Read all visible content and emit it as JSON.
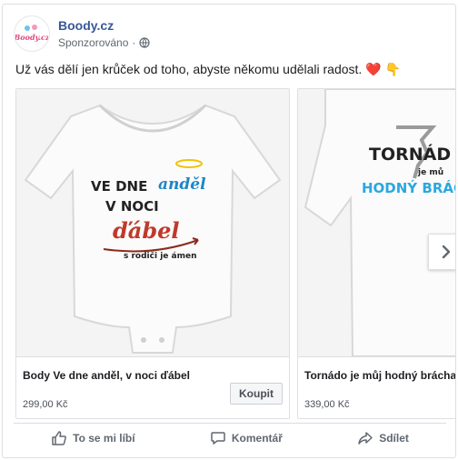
{
  "page": {
    "name": "Boody.cz",
    "logo_text": "Boody.cz",
    "sponsored": "Sponzorováno",
    "separator": "·",
    "icons": [
      "globe-icon"
    ]
  },
  "post": {
    "message": "Už vás dělí jen krůček od toho, abyste někomu udělali radost. ❤️ 👇"
  },
  "carousel": {
    "cards": [
      {
        "image_lines": [
          "VE DNE",
          "anděl",
          "V NOCI",
          "ďábel",
          "s rodiči je ámen"
        ],
        "title": "Body Ve dne anděl, v noci ďábel",
        "price": "299,00 Kč",
        "cta": "Koupit"
      },
      {
        "image_lines": [
          "TORNÁD",
          "je mů",
          "HODNÝ BRÁC"
        ],
        "title": "Tornádo je můj hodný brácha",
        "price": "339,00 Kč"
      }
    ],
    "next_icon": "chevron-right-icon"
  },
  "actions": {
    "like": "To se mi líbí",
    "comment": "Komentář",
    "share": "Sdílet"
  },
  "colors": {
    "link": "#385898",
    "text": "#1c1e21",
    "muted": "#606770",
    "border": "#dddfe2",
    "red": "#c0392b",
    "blue": "#29a8e0"
  }
}
